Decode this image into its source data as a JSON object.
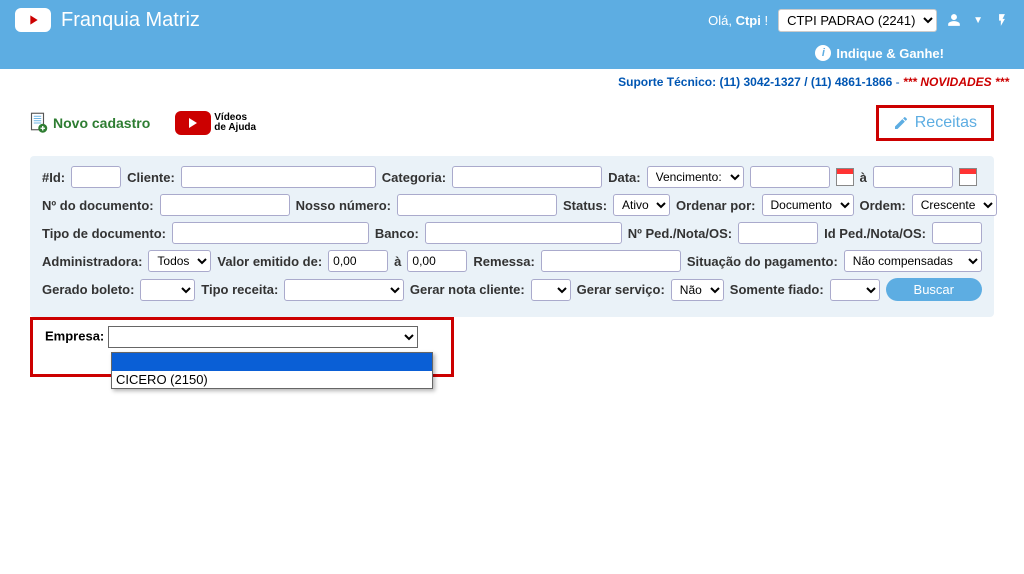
{
  "header": {
    "brand": "Franquia Matriz",
    "greeting": "Olá, ",
    "user": "Ctpi",
    "sep": " ! ",
    "account_selected": "CTPI PADRAO (2241)"
  },
  "subheader": {
    "text": "Indique & Ganhe!"
  },
  "support": {
    "label": "Suporte Técnico: ",
    "phone1": "(11) 3042-1327",
    "sep": " / ",
    "phone2": "(11) 4861-1866",
    "dash": " - ",
    "novidades": "*** NOVIDADES ***"
  },
  "toolbar": {
    "novo_cadastro": "Novo cadastro",
    "videos": "Vídeos",
    "de_ajuda": "de Ajuda",
    "youtube_sub": "YouTube",
    "receitas": "Receitas"
  },
  "filters": {
    "id": "#Id:",
    "cliente": "Cliente:",
    "categoria": "Categoria:",
    "data": "Data:",
    "vencimento": "Vencimento:",
    "a": "à",
    "ndoc": "Nº do documento:",
    "nosso": "Nosso número:",
    "status": "Status:",
    "status_val": "Ativo",
    "ordenar": "Ordenar por:",
    "ordenar_val": "Documento",
    "ordem": "Ordem:",
    "ordem_val": "Crescente",
    "tipodoc": "Tipo de documento:",
    "banco": "Banco:",
    "nped": "Nº Ped./Nota/OS:",
    "idped": "Id Ped./Nota/OS:",
    "admin": "Administradora:",
    "admin_val": "Todos",
    "valor_emitido": "Valor emitido de:",
    "zero": "0,00",
    "remessa": "Remessa:",
    "situacao": "Situação do pagamento:",
    "situacao_val": "Não compensadas",
    "gerado_boleto": "Gerado boleto:",
    "tipo_receita": "Tipo receita:",
    "gerar_nota": "Gerar nota cliente:",
    "gerar_servico": "Gerar serviço:",
    "gerar_servico_val": "Não",
    "somente_fiado": "Somente fiado:",
    "buscar": "Buscar",
    "empresa": "Empresa:",
    "empresa_opt_blank": "",
    "empresa_opt1": "CICERO (2150)"
  }
}
